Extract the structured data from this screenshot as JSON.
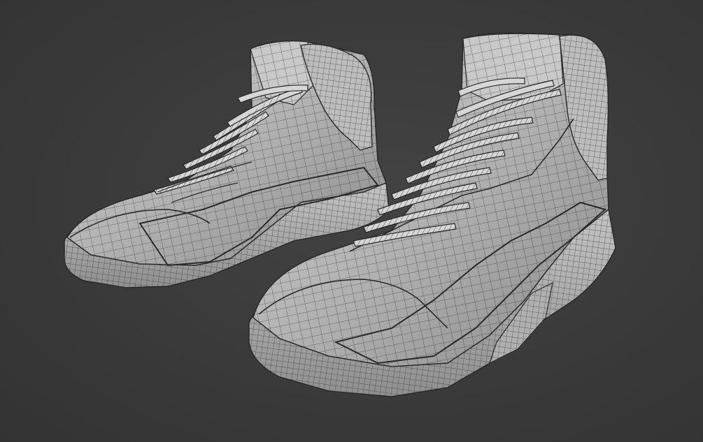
{
  "scene": {
    "background_color": "#3a3a3a",
    "shading": "clay wireframe",
    "mesh_color": "#b9b9b9",
    "wire_color": "#2e2e2e",
    "objects": [
      {
        "label": "left-sneaker",
        "icon": "sneaker-mesh"
      },
      {
        "label": "right-sneaker",
        "icon": "sneaker-mesh"
      }
    ]
  }
}
